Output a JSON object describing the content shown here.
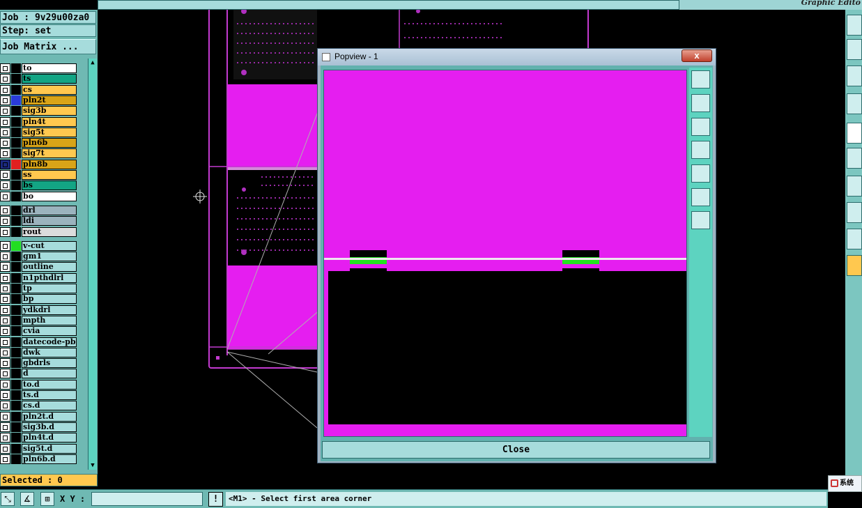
{
  "top_bar": {
    "title": "Graphic Edito"
  },
  "left_panel": {
    "job_label": "Job : 9v29u00za0",
    "step_label": "Step: set",
    "job_matrix_button": "Job Matrix ...",
    "layers": [
      {
        "name": "to",
        "color": "#ffffff",
        "swatch": "#000000"
      },
      {
        "name": "ts",
        "color": "#13a584",
        "swatch": "#000000"
      },
      {
        "name": "cs",
        "color": "#ffc84f",
        "swatch": "#000000"
      },
      {
        "name": "pln2t",
        "color": "#d8a418",
        "swatch": "#2a3bd8"
      },
      {
        "name": "sig3b",
        "color": "#ffc84f",
        "swatch": "#000000"
      },
      {
        "name": "pln4t",
        "color": "#ffc84f",
        "swatch": "#000000"
      },
      {
        "name": "sig5t",
        "color": "#ffc84f",
        "swatch": "#000000"
      },
      {
        "name": "pln6b",
        "color": "#d8a418",
        "swatch": "#000000"
      },
      {
        "name": "sig7t",
        "color": "#ffc84f",
        "swatch": "#000000"
      },
      {
        "name": "pln8b",
        "color": "#d8a418",
        "swatch": "#e02020",
        "active": true
      },
      {
        "name": "ss",
        "color": "#ffc84f",
        "swatch": "#000000"
      },
      {
        "name": "bs",
        "color": "#13a584",
        "swatch": "#000000"
      },
      {
        "name": "bo",
        "color": "#ffffff",
        "swatch": "#000000"
      },
      {
        "name": "drl",
        "color": "#9bb3bd",
        "swatch": "#000000",
        "gap": true
      },
      {
        "name": "ldi",
        "color": "#9bb3bd",
        "swatch": "#000000"
      },
      {
        "name": "rout",
        "color": "#dcdcdc",
        "swatch": "#000000"
      },
      {
        "name": "v-cut",
        "color": "#a6dcdc",
        "swatch": "#22dd22",
        "gap": true
      },
      {
        "name": "gm1",
        "color": "#a6dcdc",
        "swatch": "#000000"
      },
      {
        "name": "outline",
        "color": "#a6dcdc",
        "swatch": "#000000"
      },
      {
        "name": "n1pthdlrl",
        "color": "#a6dcdc",
        "swatch": "#000000"
      },
      {
        "name": "tp",
        "color": "#a6dcdc",
        "swatch": "#000000"
      },
      {
        "name": "bp",
        "color": "#a6dcdc",
        "swatch": "#000000"
      },
      {
        "name": "ydkdrl",
        "color": "#a6dcdc",
        "swatch": "#000000"
      },
      {
        "name": "mpth",
        "color": "#a6dcdc",
        "swatch": "#000000"
      },
      {
        "name": "cvia",
        "color": "#a6dcdc",
        "swatch": "#000000"
      },
      {
        "name": "datecode-pbe",
        "color": "#a6dcdc",
        "swatch": "#000000"
      },
      {
        "name": "dwk",
        "color": "#a6dcdc",
        "swatch": "#000000"
      },
      {
        "name": "gbdrls",
        "color": "#a6dcdc",
        "swatch": "#000000"
      },
      {
        "name": "d",
        "color": "#a6dcdc",
        "swatch": "#000000"
      },
      {
        "name": "to.d",
        "color": "#a6dcdc",
        "swatch": "#000000"
      },
      {
        "name": "ts.d",
        "color": "#a6dcdc",
        "swatch": "#000000"
      },
      {
        "name": "cs.d",
        "color": "#a6dcdc",
        "swatch": "#000000"
      },
      {
        "name": "pln2t.d",
        "color": "#a6dcdc",
        "swatch": "#000000"
      },
      {
        "name": "sig3b.d",
        "color": "#a6dcdc",
        "swatch": "#000000"
      },
      {
        "name": "pln4t.d",
        "color": "#a6dcdc",
        "swatch": "#000000"
      },
      {
        "name": "sig5t.d",
        "color": "#a6dcdc",
        "swatch": "#000000"
      },
      {
        "name": "pln6b.d",
        "color": "#a6dcdc",
        "swatch": "#000000"
      }
    ],
    "selected_label": "Selected : 0"
  },
  "bottom_bar": {
    "xy_label": "X Y :",
    "xy_value": "",
    "excl": "!",
    "message": "<M1> - Select first area corner"
  },
  "popview": {
    "title": "Popview - 1",
    "close_x": "x",
    "close_button": "Close",
    "colors": {
      "magenta": "#e51ef0",
      "green": "#22e31f",
      "white": "#f0e6f0"
    }
  },
  "taskbar": {
    "label": "系统"
  },
  "icons": {
    "popview_tools": [
      "zoom-window-icon",
      "pan-up-icon",
      "pan-down-icon",
      "pan-left-icon",
      "pan-right-icon",
      "zoom-fit-icon",
      "zoom-home-icon"
    ],
    "right_tools": [
      "new-icon",
      "move-icon",
      "zoom-icon",
      "layer-icon",
      "circle-icon",
      "route-icon",
      "line-icon",
      "snap-icon",
      "angle-icon",
      "pointer-icon"
    ]
  }
}
